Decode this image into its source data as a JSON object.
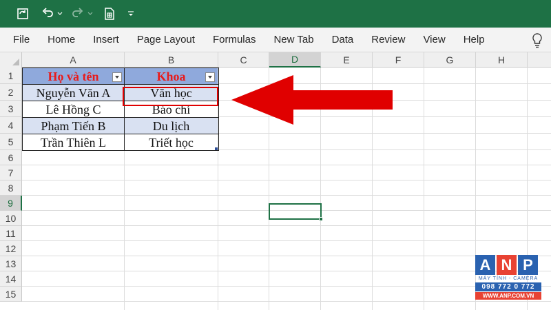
{
  "ribbon": {
    "menu": [
      "File",
      "Home",
      "Insert",
      "Page Layout",
      "Formulas",
      "New Tab",
      "Data",
      "Review",
      "View",
      "Help"
    ]
  },
  "columns": [
    "A",
    "B",
    "C",
    "D",
    "E",
    "F",
    "G",
    "H"
  ],
  "rows": [
    "1",
    "2",
    "3",
    "4",
    "5",
    "6",
    "7",
    "8",
    "9",
    "10",
    "11",
    "12",
    "13",
    "14",
    "15"
  ],
  "table": {
    "headers": [
      "Họ và tên",
      "Khoa"
    ],
    "rows": [
      [
        "Nguyễn Văn A",
        "Văn học"
      ],
      [
        "Lê Hồng C",
        "Báo chí"
      ],
      [
        "Phạm Tiến B",
        "Du lịch"
      ],
      [
        "Trần Thiên L",
        "Triết học"
      ]
    ]
  },
  "colors": {
    "excel_green": "#1e7145",
    "header_fill": "#8fa9dc",
    "band_fill": "#d9e1f2",
    "header_text": "#e81b1b",
    "annotation_red": "#e00000"
  },
  "logo": {
    "letters": [
      "A",
      "N",
      "P"
    ],
    "letter_colors": [
      "#2a62b0",
      "#e84233",
      "#2a62b0"
    ],
    "tagline": "MÁY TÍNH - CAMERA",
    "phone": "098 772 0 772",
    "website": "WWW.ANP.COM.VN"
  }
}
